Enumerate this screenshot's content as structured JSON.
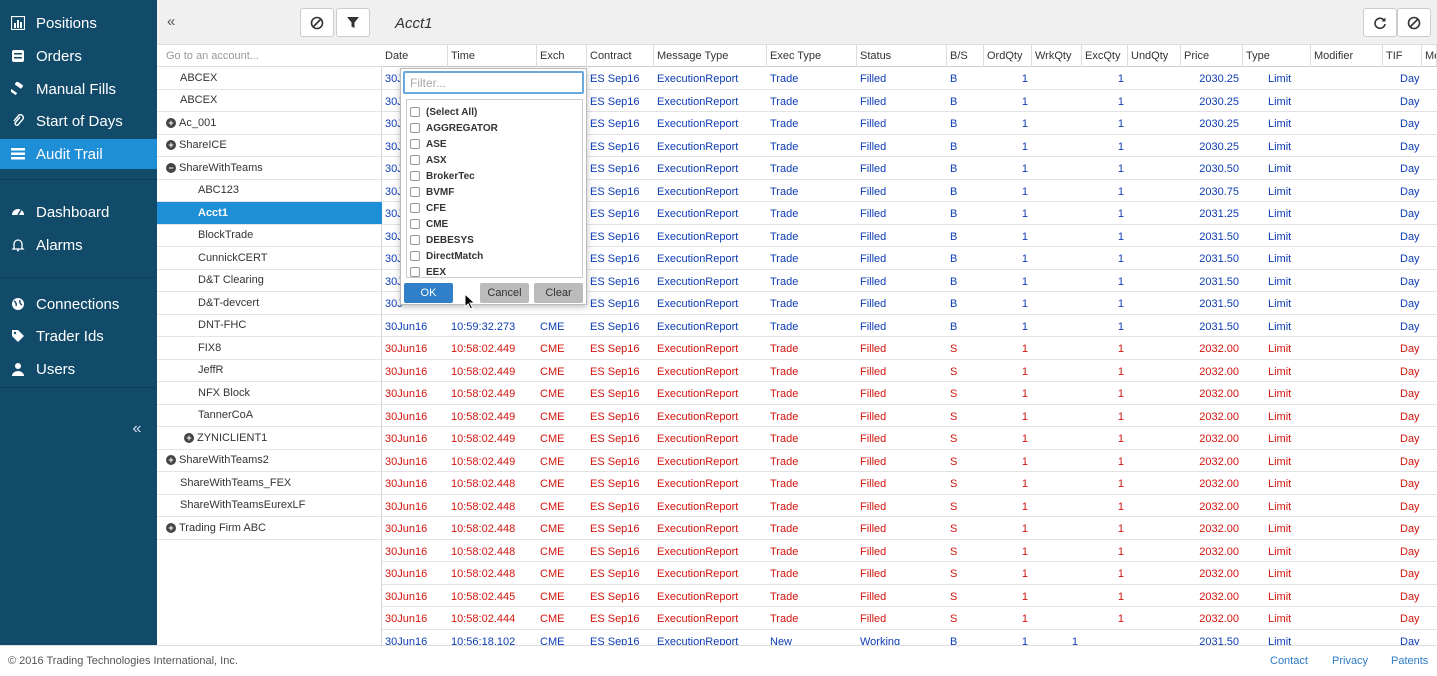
{
  "nav": {
    "items": [
      {
        "label": "Positions",
        "icon": "bar-chart-icon",
        "active": false
      },
      {
        "label": "Orders",
        "icon": "orders-book-icon",
        "active": false
      },
      {
        "label": "Manual Fills",
        "icon": "hammer-icon",
        "active": false
      },
      {
        "label": "Start of Days",
        "icon": "paperclip-icon",
        "active": false
      },
      {
        "label": "Audit Trail",
        "icon": "list-icon",
        "active": true
      },
      {
        "label": "Dashboard",
        "icon": "dashboard-icon",
        "active": false
      },
      {
        "label": "Alarms",
        "icon": "bell-icon",
        "active": false
      },
      {
        "label": "Connections",
        "icon": "globe-icon",
        "active": false
      },
      {
        "label": "Trader Ids",
        "icon": "tags-icon",
        "active": false
      },
      {
        "label": "Users",
        "icon": "user-icon",
        "active": false
      }
    ],
    "collapse_glyph": "«"
  },
  "accounts": {
    "collapse_glyph": "«",
    "search_placeholder": "Go to an account...",
    "items": [
      {
        "label": "ABCEX",
        "indent": 1,
        "toggle": ""
      },
      {
        "label": "ABCEX",
        "indent": 1,
        "toggle": ""
      },
      {
        "label": "Ac_001",
        "indent": 0,
        "toggle": "+"
      },
      {
        "label": "ShareICE",
        "indent": 0,
        "toggle": "+"
      },
      {
        "label": "ShareWithTeams",
        "indent": 0,
        "toggle": "−"
      },
      {
        "label": "ABC123",
        "indent": 2,
        "toggle": ""
      },
      {
        "label": "Acct1",
        "indent": 2,
        "toggle": "",
        "selected": true
      },
      {
        "label": "BlockTrade",
        "indent": 2,
        "toggle": ""
      },
      {
        "label": "CunnickCERT",
        "indent": 2,
        "toggle": ""
      },
      {
        "label": "D&T Clearing",
        "indent": 2,
        "toggle": ""
      },
      {
        "label": "D&T-devcert",
        "indent": 2,
        "toggle": ""
      },
      {
        "label": "DNT-FHC",
        "indent": 2,
        "toggle": ""
      },
      {
        "label": "FIX8",
        "indent": 2,
        "toggle": ""
      },
      {
        "label": "JeffR",
        "indent": 2,
        "toggle": ""
      },
      {
        "label": "NFX Block",
        "indent": 2,
        "toggle": ""
      },
      {
        "label": "TannerCoA",
        "indent": 2,
        "toggle": ""
      },
      {
        "label": "ZYNICLIENT1",
        "indent": 3,
        "toggle": "+"
      },
      {
        "label": "ShareWithTeams2",
        "indent": 0,
        "toggle": "+"
      },
      {
        "label": "ShareWithTeams_FEX",
        "indent": 1,
        "toggle": ""
      },
      {
        "label": "ShareWithTeamsEurexLF",
        "indent": 1,
        "toggle": ""
      },
      {
        "label": "Trading Firm ABC",
        "indent": 0,
        "toggle": "+"
      }
    ]
  },
  "main": {
    "title": "Acct1",
    "columns": [
      "Date",
      "Time",
      "Exch",
      "Contract",
      "Message Type",
      "Exec Type",
      "Status",
      "B/S",
      "OrdQty",
      "WrkQty",
      "ExcQty",
      "UndQty",
      "Price",
      "Type",
      "Modifier",
      "TIF",
      "Me"
    ],
    "rows": [
      [
        "30J",
        "",
        "",
        "ES Sep16",
        "ExecutionReport",
        "Trade",
        "Filled",
        "B",
        "1",
        "",
        "1",
        "",
        "2030.25",
        "Limit",
        "",
        "Day"
      ],
      [
        "30J",
        "",
        "",
        "ES Sep16",
        "ExecutionReport",
        "Trade",
        "Filled",
        "B",
        "1",
        "",
        "1",
        "",
        "2030.25",
        "Limit",
        "",
        "Day"
      ],
      [
        "30J",
        "",
        "",
        "ES Sep16",
        "ExecutionReport",
        "Trade",
        "Filled",
        "B",
        "1",
        "",
        "1",
        "",
        "2030.25",
        "Limit",
        "",
        "Day"
      ],
      [
        "30J",
        "",
        "",
        "ES Sep16",
        "ExecutionReport",
        "Trade",
        "Filled",
        "B",
        "1",
        "",
        "1",
        "",
        "2030.25",
        "Limit",
        "",
        "Day"
      ],
      [
        "30J",
        "",
        "",
        "ES Sep16",
        "ExecutionReport",
        "Trade",
        "Filled",
        "B",
        "1",
        "",
        "1",
        "",
        "2030.50",
        "Limit",
        "",
        "Day"
      ],
      [
        "30J",
        "",
        "",
        "ES Sep16",
        "ExecutionReport",
        "Trade",
        "Filled",
        "B",
        "1",
        "",
        "1",
        "",
        "2030.75",
        "Limit",
        "",
        "Day"
      ],
      [
        "30J",
        "",
        "",
        "ES Sep16",
        "ExecutionReport",
        "Trade",
        "Filled",
        "B",
        "1",
        "",
        "1",
        "",
        "2031.25",
        "Limit",
        "",
        "Day"
      ],
      [
        "30J",
        "",
        "",
        "ES Sep16",
        "ExecutionReport",
        "Trade",
        "Filled",
        "B",
        "1",
        "",
        "1",
        "",
        "2031.50",
        "Limit",
        "",
        "Day"
      ],
      [
        "30J",
        "",
        "",
        "ES Sep16",
        "ExecutionReport",
        "Trade",
        "Filled",
        "B",
        "1",
        "",
        "1",
        "",
        "2031.50",
        "Limit",
        "",
        "Day"
      ],
      [
        "30J",
        "",
        "",
        "ES Sep16",
        "ExecutionReport",
        "Trade",
        "Filled",
        "B",
        "1",
        "",
        "1",
        "",
        "2031.50",
        "Limit",
        "",
        "Day"
      ],
      [
        "30J",
        "",
        "",
        "ES Sep16",
        "ExecutionReport",
        "Trade",
        "Filled",
        "B",
        "1",
        "",
        "1",
        "",
        "2031.50",
        "Limit",
        "",
        "Day"
      ],
      [
        "30Jun16",
        "10:59:32.273",
        "CME",
        "ES Sep16",
        "ExecutionReport",
        "Trade",
        "Filled",
        "B",
        "1",
        "",
        "1",
        "",
        "2031.50",
        "Limit",
        "",
        "Day"
      ],
      [
        "30Jun16",
        "10:58:02.449",
        "CME",
        "ES Sep16",
        "ExecutionReport",
        "Trade",
        "Filled",
        "S",
        "1",
        "",
        "1",
        "",
        "2032.00",
        "Limit",
        "",
        "Day"
      ],
      [
        "30Jun16",
        "10:58:02.449",
        "CME",
        "ES Sep16",
        "ExecutionReport",
        "Trade",
        "Filled",
        "S",
        "1",
        "",
        "1",
        "",
        "2032.00",
        "Limit",
        "",
        "Day"
      ],
      [
        "30Jun16",
        "10:58:02.449",
        "CME",
        "ES Sep16",
        "ExecutionReport",
        "Trade",
        "Filled",
        "S",
        "1",
        "",
        "1",
        "",
        "2032.00",
        "Limit",
        "",
        "Day"
      ],
      [
        "30Jun16",
        "10:58:02.449",
        "CME",
        "ES Sep16",
        "ExecutionReport",
        "Trade",
        "Filled",
        "S",
        "1",
        "",
        "1",
        "",
        "2032.00",
        "Limit",
        "",
        "Day"
      ],
      [
        "30Jun16",
        "10:58:02.449",
        "CME",
        "ES Sep16",
        "ExecutionReport",
        "Trade",
        "Filled",
        "S",
        "1",
        "",
        "1",
        "",
        "2032.00",
        "Limit",
        "",
        "Day"
      ],
      [
        "30Jun16",
        "10:58:02.449",
        "CME",
        "ES Sep16",
        "ExecutionReport",
        "Trade",
        "Filled",
        "S",
        "1",
        "",
        "1",
        "",
        "2032.00",
        "Limit",
        "",
        "Day"
      ],
      [
        "30Jun16",
        "10:58:02.448",
        "CME",
        "ES Sep16",
        "ExecutionReport",
        "Trade",
        "Filled",
        "S",
        "1",
        "",
        "1",
        "",
        "2032.00",
        "Limit",
        "",
        "Day"
      ],
      [
        "30Jun16",
        "10:58:02.448",
        "CME",
        "ES Sep16",
        "ExecutionReport",
        "Trade",
        "Filled",
        "S",
        "1",
        "",
        "1",
        "",
        "2032.00",
        "Limit",
        "",
        "Day"
      ],
      [
        "30Jun16",
        "10:58:02.448",
        "CME",
        "ES Sep16",
        "ExecutionReport",
        "Trade",
        "Filled",
        "S",
        "1",
        "",
        "1",
        "",
        "2032.00",
        "Limit",
        "",
        "Day"
      ],
      [
        "30Jun16",
        "10:58:02.448",
        "CME",
        "ES Sep16",
        "ExecutionReport",
        "Trade",
        "Filled",
        "S",
        "1",
        "",
        "1",
        "",
        "2032.00",
        "Limit",
        "",
        "Day"
      ],
      [
        "30Jun16",
        "10:58:02.448",
        "CME",
        "ES Sep16",
        "ExecutionReport",
        "Trade",
        "Filled",
        "S",
        "1",
        "",
        "1",
        "",
        "2032.00",
        "Limit",
        "",
        "Day"
      ],
      [
        "30Jun16",
        "10:58:02.445",
        "CME",
        "ES Sep16",
        "ExecutionReport",
        "Trade",
        "Filled",
        "S",
        "1",
        "",
        "1",
        "",
        "2032.00",
        "Limit",
        "",
        "Day"
      ],
      [
        "30Jun16",
        "10:58:02.444",
        "CME",
        "ES Sep16",
        "ExecutionReport",
        "Trade",
        "Filled",
        "S",
        "1",
        "",
        "1",
        "",
        "2032.00",
        "Limit",
        "",
        "Day"
      ],
      [
        "30Jun16",
        "10:56:18.102",
        "CME",
        "ES Sep16",
        "ExecutionReport",
        "New",
        "Working",
        "B",
        "1",
        "1",
        "",
        "",
        "2031.50",
        "Limit",
        "",
        "Day"
      ]
    ]
  },
  "filter": {
    "placeholder": "Filter...",
    "options": [
      "(Select All)",
      "AGGREGATOR",
      "ASE",
      "ASX",
      "BrokerTec",
      "BVMF",
      "CFE",
      "CME",
      "DEBESYS",
      "DirectMatch",
      "EEX"
    ],
    "ok_label": "OK",
    "cancel_label": "Cancel",
    "clear_label": "Clear"
  },
  "footer": {
    "copyright": "© 2016 Trading Technologies International, Inc.",
    "links": [
      "Contact",
      "Privacy",
      "Patents"
    ]
  },
  "colors": {
    "nav_bg": "#124a6a",
    "accent": "#1e8ed6",
    "buy": "#0d3cb4",
    "sell": "#d4140c"
  }
}
